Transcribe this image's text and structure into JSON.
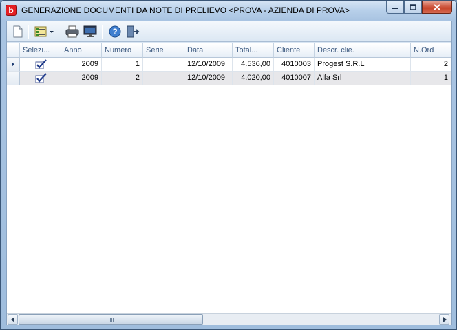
{
  "window": {
    "title": "GENERAZIONE DOCUMENTI DA NOTE DI PRELIEVO <PROVA - AZIENDA DI PROVA>",
    "app_icon_letter": "b",
    "controls": [
      "minimize",
      "maximize",
      "close"
    ]
  },
  "toolbar": {
    "buttons": [
      {
        "name": "new-document",
        "icon": "new-document-icon"
      },
      {
        "name": "select-menu",
        "icon": "checklist-dropdown-icon"
      },
      {
        "name": "print",
        "icon": "printer-icon"
      },
      {
        "name": "preview",
        "icon": "monitor-icon"
      },
      {
        "name": "help",
        "icon": "help-icon"
      },
      {
        "name": "exit",
        "icon": "exit-door-icon"
      }
    ]
  },
  "grid": {
    "columns": [
      "Selezi...",
      "Anno",
      "Numero",
      "Serie",
      "Data",
      "Total...",
      "Cliente",
      "Descr. clie.",
      "N.Ord"
    ],
    "rows": [
      {
        "selected": true,
        "current": true,
        "anno": "2009",
        "numero": "1",
        "serie": "",
        "data": "12/10/2009",
        "totale": "4.536,00",
        "cliente": "4010003",
        "descr": "Progest S.R.L",
        "nord": "2"
      },
      {
        "selected": true,
        "current": false,
        "anno": "2009",
        "numero": "2",
        "serie": "",
        "data": "12/10/2009",
        "totale": "4.020,00",
        "cliente": "4010007",
        "descr": "Alfa Srl",
        "nord": "1"
      }
    ]
  },
  "colors": {
    "title_bar": "#b8d0ea",
    "header_text": "#3d5a80",
    "alt_row": "#e7e7ea",
    "close_button": "#c8452b"
  }
}
